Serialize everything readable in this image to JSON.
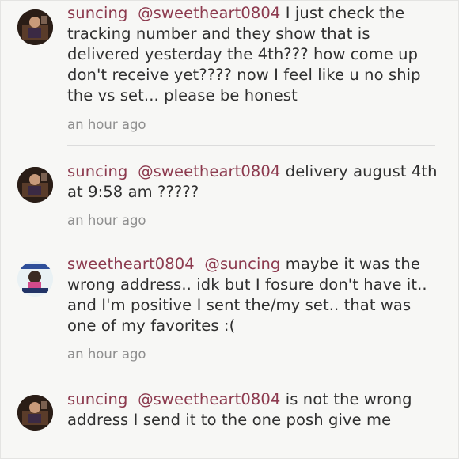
{
  "comments": [
    {
      "username": "suncing",
      "mention": "@sweetheart0804",
      "text": "I just check the tracking number and they show that is delivered yesterday the 4th??? how come up don't receive yet???? now I feel like u no ship the vs set... please be honest",
      "time": "an hour ago",
      "avatar_icon": "user-avatar-suncing"
    },
    {
      "username": "suncing",
      "mention": "@sweetheart0804",
      "text": "delivery august 4th at 9:58 am ?????",
      "time": "an hour ago",
      "avatar_icon": "user-avatar-suncing"
    },
    {
      "username": "sweetheart0804",
      "mention": "@suncing",
      "text": "maybe it was the wrong address.. idk but I fosure don't have it.. and I'm positive I sent the/my set.. that was one of my favorites :(",
      "time": "an hour ago",
      "avatar_icon": "user-avatar-sweetheart0804"
    },
    {
      "username": "suncing",
      "mention": "@sweetheart0804",
      "text": "is not the wrong address I send it to the one posh give me",
      "time": "",
      "avatar_icon": "user-avatar-suncing"
    }
  ],
  "colors": {
    "username": "#8c3a4e",
    "timestamp": "#8e8e8e",
    "divider": "#dcdcdc"
  }
}
